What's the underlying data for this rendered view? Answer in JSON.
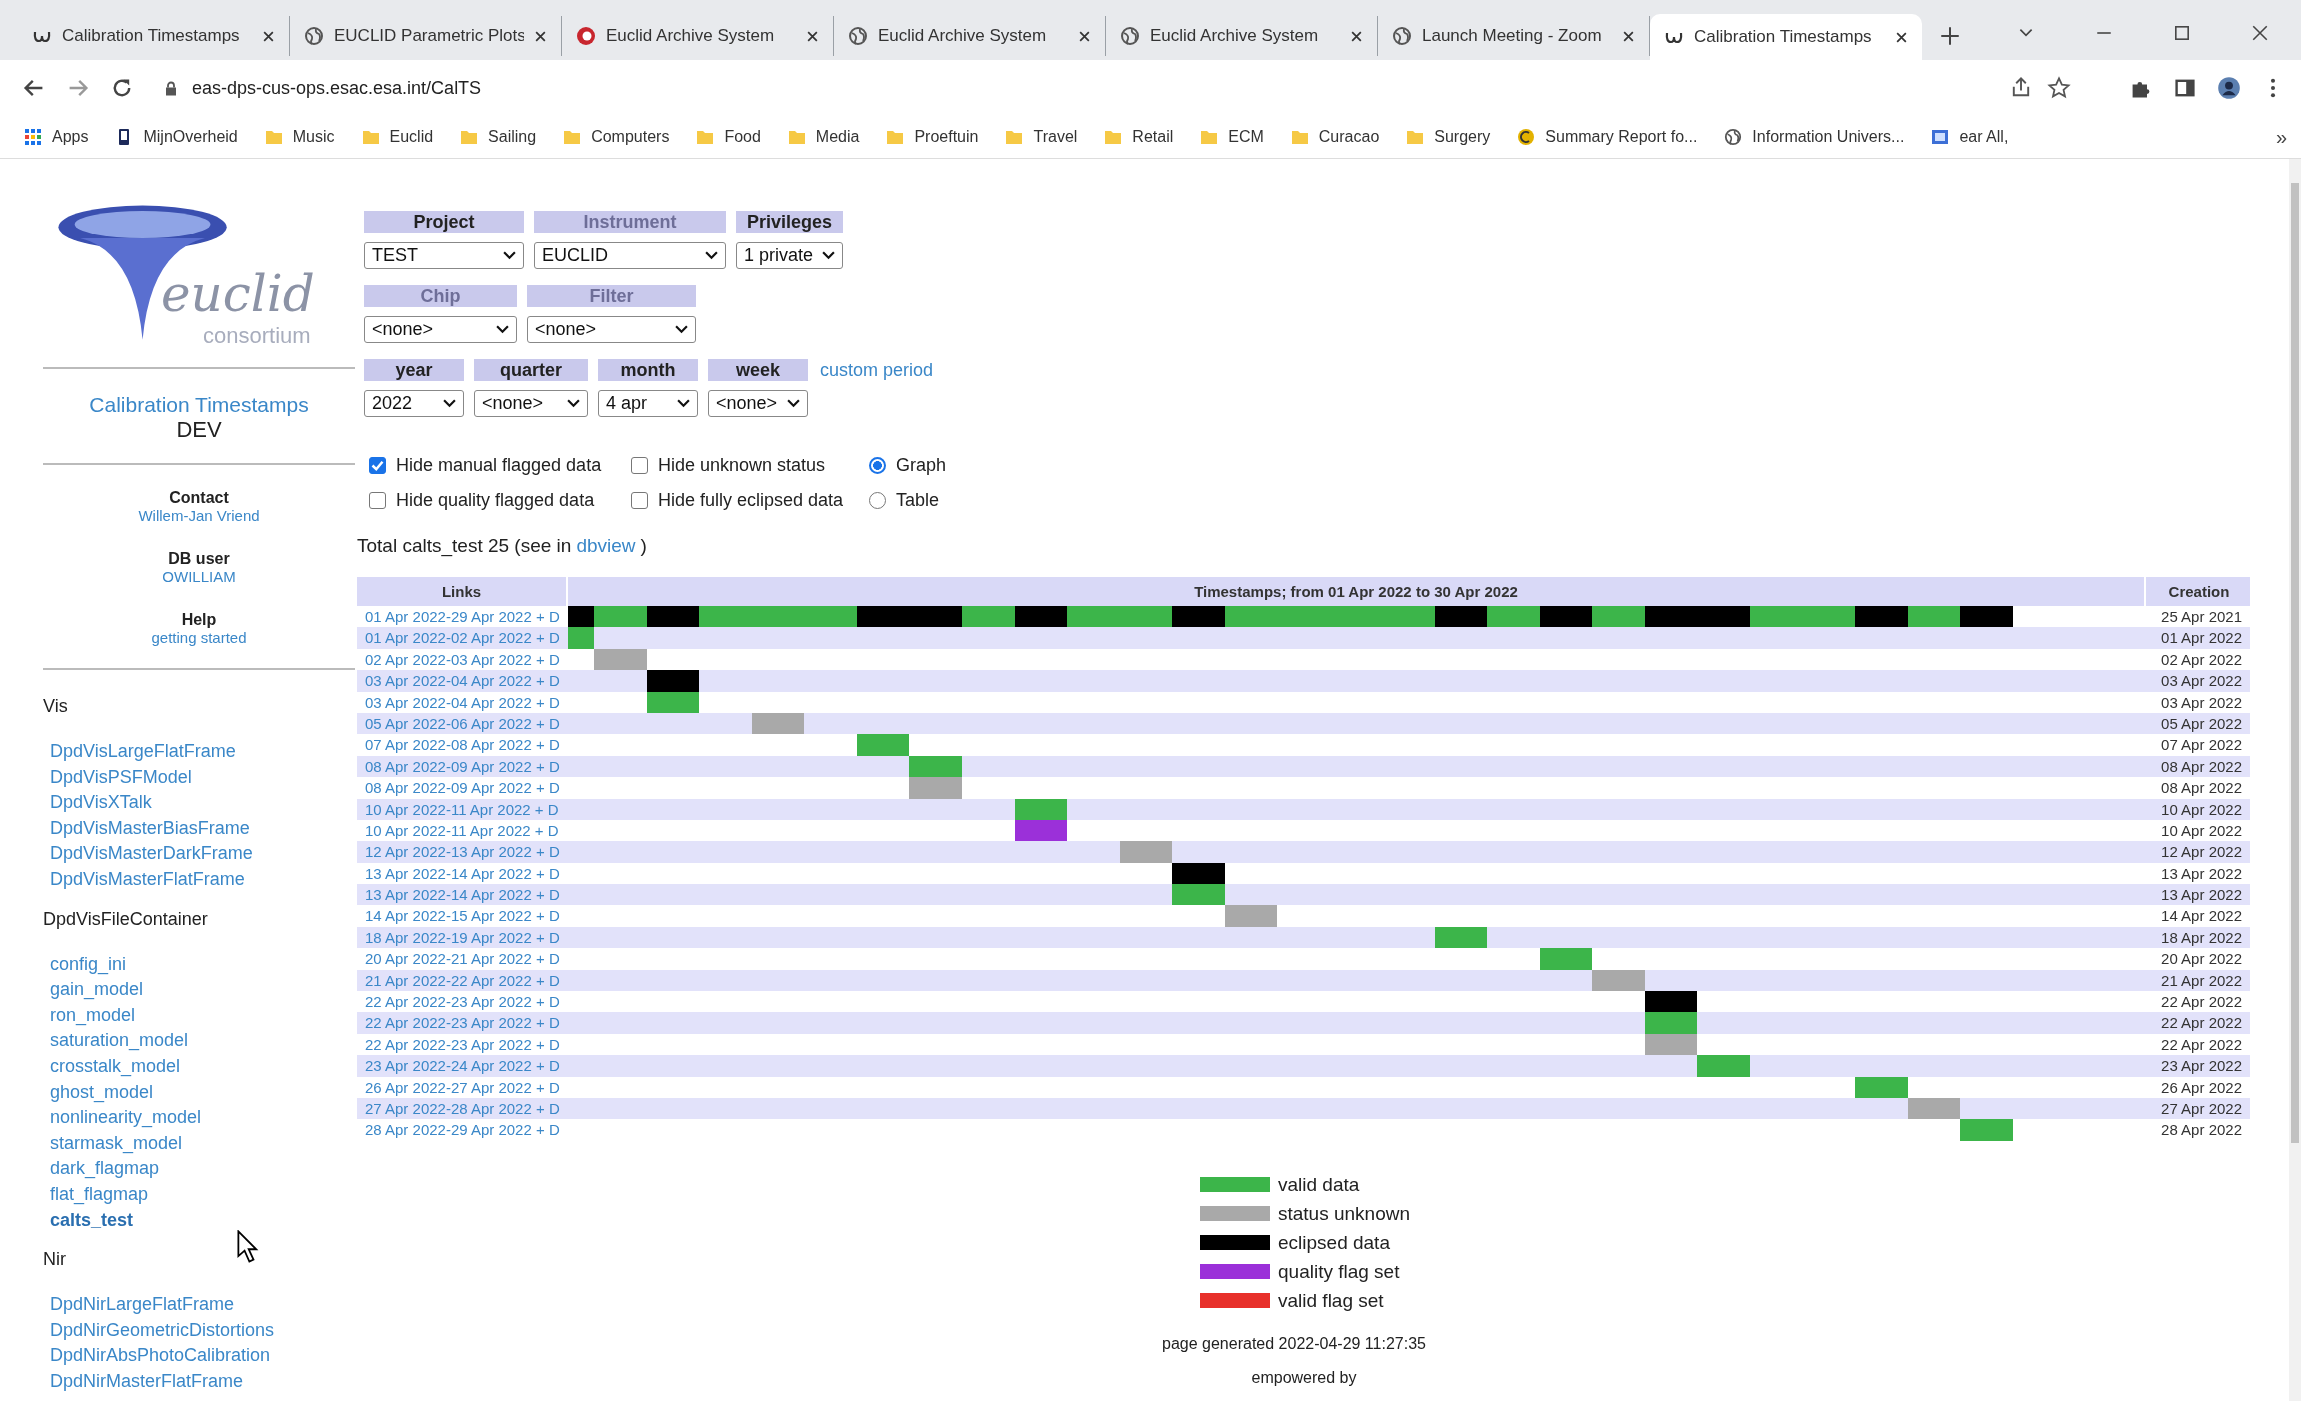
{
  "browser": {
    "tabs": [
      {
        "title": "Calibration Timestamps",
        "kind": "euclid",
        "selected": false
      },
      {
        "title": "EUCLID Parametric Plots",
        "kind": "globe",
        "selected": false
      },
      {
        "title": "Euclid Archive System",
        "kind": "archive",
        "selected": false
      },
      {
        "title": "Euclid Archive System",
        "kind": "globe",
        "selected": false
      },
      {
        "title": "Euclid Archive System",
        "kind": "globe",
        "selected": false
      },
      {
        "title": "Launch Meeting - Zoom",
        "kind": "globe",
        "selected": false
      },
      {
        "title": "Calibration Timestamps",
        "kind": "euclid",
        "selected": true
      }
    ],
    "address": "eas-dps-cus-ops.esac.esa.int/CalTS",
    "bookmarks": [
      {
        "label": "Apps",
        "kind": "apps"
      },
      {
        "label": "MijnOverheid",
        "kind": "device"
      },
      {
        "label": "Music",
        "kind": "folder"
      },
      {
        "label": "Euclid",
        "kind": "folder"
      },
      {
        "label": "Sailing",
        "kind": "folder"
      },
      {
        "label": "Computers",
        "kind": "folder"
      },
      {
        "label": "Food",
        "kind": "folder"
      },
      {
        "label": "Media",
        "kind": "folder"
      },
      {
        "label": "Proeftuin",
        "kind": "folder"
      },
      {
        "label": "Travel",
        "kind": "folder"
      },
      {
        "label": "Retail",
        "kind": "folder"
      },
      {
        "label": "ECM",
        "kind": "folder"
      },
      {
        "label": "Curacao",
        "kind": "folder"
      },
      {
        "label": "Surgery",
        "kind": "folder"
      },
      {
        "label": "Summary Report fo...",
        "kind": "coin"
      },
      {
        "label": "Information Univers...",
        "kind": "globe"
      },
      {
        "label": "ear All,",
        "kind": "doc"
      }
    ],
    "overflow": "»"
  },
  "sidebar": {
    "logo": {
      "word": "euclid",
      "sub": "consortium"
    },
    "title": "Calibration Timestamps",
    "env": "DEV",
    "info": [
      {
        "label": "Contact",
        "link": "Willem-Jan Vriend"
      },
      {
        "label": "DB user",
        "link": "OWILLIAM"
      },
      {
        "label": "Help",
        "link": "getting started"
      }
    ],
    "sections": [
      {
        "title": "Vis",
        "items": [
          {
            "label": "DpdVisLargeFlatFrame",
            "selected": false
          },
          {
            "label": "DpdVisPSFModel",
            "selected": false
          },
          {
            "label": "DpdVisXTalk",
            "selected": false
          },
          {
            "label": "DpdVisMasterBiasFrame",
            "selected": false
          },
          {
            "label": "DpdVisMasterDarkFrame",
            "selected": false
          },
          {
            "label": "DpdVisMasterFlatFrame",
            "selected": false
          }
        ]
      },
      {
        "title": "DpdVisFileContainer",
        "items": [
          {
            "label": "config_ini",
            "selected": false
          },
          {
            "label": "gain_model",
            "selected": false
          },
          {
            "label": "ron_model",
            "selected": false
          },
          {
            "label": "saturation_model",
            "selected": false
          },
          {
            "label": "crosstalk_model",
            "selected": false
          },
          {
            "label": "ghost_model",
            "selected": false
          },
          {
            "label": "nonlinearity_model",
            "selected": false
          },
          {
            "label": "starmask_model",
            "selected": false
          },
          {
            "label": "dark_flagmap",
            "selected": false
          },
          {
            "label": "flat_flagmap",
            "selected": false
          },
          {
            "label": "calts_test",
            "selected": true
          }
        ]
      },
      {
        "title": "Nir",
        "items": [
          {
            "label": "DpdNirLargeFlatFrame",
            "selected": false
          },
          {
            "label": "DpdNirGeometricDistortions",
            "selected": false
          },
          {
            "label": "DpdNirAbsPhotoCalibration",
            "selected": false
          },
          {
            "label": "DpdNirMasterFlatFrame",
            "selected": false
          }
        ]
      }
    ]
  },
  "filters": [
    [
      {
        "label": "Project",
        "value": "TEST",
        "disabled": false
      },
      {
        "label": "Instrument",
        "value": "EUCLID",
        "disabled": true
      },
      {
        "label": "Privileges",
        "value": "1 private",
        "disabled": false
      }
    ],
    [
      {
        "label": "Chip",
        "value": "<none>",
        "disabled": true
      },
      {
        "label": "Filter",
        "value": "<none>",
        "disabled": true
      }
    ],
    [
      {
        "label": "year",
        "value": "2022",
        "disabled": false
      },
      {
        "label": "quarter",
        "value": "<none>",
        "disabled": false
      },
      {
        "label": "month",
        "value": "4 apr",
        "disabled": false
      },
      {
        "label": "week",
        "value": "<none>",
        "disabled": false
      }
    ]
  ],
  "custom_period": "custom period",
  "checkboxes": [
    {
      "label": "Hide manual flagged data",
      "checked": true
    },
    {
      "label": "Hide unknown status",
      "checked": false
    },
    {
      "label": "Hide quality flagged data",
      "checked": false
    },
    {
      "label": "Hide fully eclipsed data",
      "checked": false
    }
  ],
  "views": [
    {
      "label": "Graph",
      "selected": true
    },
    {
      "label": "Table",
      "selected": false
    }
  ],
  "total": {
    "text": "Total calts_test 25 (see in",
    "link": "dbview",
    "after": ")"
  },
  "table": {
    "columns": [
      "Links",
      "Timestamps; from 01 Apr 2022 to 30 Apr 2022",
      "Creation"
    ],
    "rows": [
      {
        "link": "01 Apr 2022-29 Apr 2022 + D",
        "created": "25 Apr 2021",
        "segments": [
          {
            "kind": "eclipsed"
          },
          {
            "kind": "valid"
          },
          {
            "kind": "eclipsed"
          },
          {
            "kind": "valid"
          },
          {
            "kind": "eclipsed"
          },
          {
            "kind": "valid"
          },
          {
            "kind": "eclipsed"
          },
          {
            "kind": "valid"
          },
          {
            "kind": "eclipsed"
          },
          {
            "kind": "valid"
          },
          {
            "kind": "eclipsed"
          },
          {
            "kind": "valid"
          },
          {
            "kind": "eclipsed"
          },
          {
            "kind": "valid"
          },
          {
            "kind": "eclipsed"
          },
          {
            "kind": "valid"
          },
          {
            "kind": "eclipsed"
          },
          {
            "kind": "valid"
          },
          {
            "kind": "eclipsed"
          }
        ]
      },
      {
        "link": "01 Apr 2022-02 Apr 2022 + D",
        "created": "01 Apr 2022",
        "segments": [
          {
            "kind": "valid"
          }
        ]
      },
      {
        "link": "02 Apr 2022-03 Apr 2022 + D",
        "created": "02 Apr 2022",
        "segments": [
          {
            "kind": "unknown"
          }
        ]
      },
      {
        "link": "03 Apr 2022-04 Apr 2022 + D",
        "created": "03 Apr 2022",
        "segments": [
          {
            "kind": "eclipsed"
          }
        ]
      },
      {
        "link": "03 Apr 2022-04 Apr 2022 + D",
        "created": "03 Apr 2022",
        "segments": [
          {
            "kind": "valid"
          }
        ]
      },
      {
        "link": "05 Apr 2022-06 Apr 2022 + D",
        "created": "05 Apr 2022",
        "segments": [
          {
            "kind": "unknown"
          }
        ]
      },
      {
        "link": "07 Apr 2022-08 Apr 2022 + D",
        "created": "07 Apr 2022",
        "segments": [
          {
            "kind": "valid"
          }
        ]
      },
      {
        "link": "08 Apr 2022-09 Apr 2022 + D",
        "created": "08 Apr 2022",
        "segments": [
          {
            "kind": "valid"
          }
        ]
      },
      {
        "link": "08 Apr 2022-09 Apr 2022 + D",
        "created": "08 Apr 2022",
        "segments": [
          {
            "kind": "unknown"
          }
        ]
      },
      {
        "link": "10 Apr 2022-11 Apr 2022 + D",
        "created": "10 Apr 2022",
        "segments": [
          {
            "kind": "valid"
          }
        ]
      },
      {
        "link": "10 Apr 2022-11 Apr 2022 + D",
        "created": "10 Apr 2022",
        "segments": [
          {
            "kind": "quality"
          }
        ]
      },
      {
        "link": "12 Apr 2022-13 Apr 2022 + D",
        "created": "12 Apr 2022",
        "segments": [
          {
            "kind": "unknown"
          }
        ]
      },
      {
        "link": "13 Apr 2022-14 Apr 2022 + D",
        "created": "13 Apr 2022",
        "segments": [
          {
            "kind": "eclipsed"
          }
        ]
      },
      {
        "link": "13 Apr 2022-14 Apr 2022 + D",
        "created": "13 Apr 2022",
        "segments": [
          {
            "kind": "valid"
          }
        ]
      },
      {
        "link": "14 Apr 2022-15 Apr 2022 + D",
        "created": "14 Apr 2022",
        "segments": [
          {
            "kind": "unknown"
          }
        ]
      },
      {
        "link": "18 Apr 2022-19 Apr 2022 + D",
        "created": "18 Apr 2022",
        "segments": [
          {
            "kind": "valid"
          }
        ]
      },
      {
        "link": "20 Apr 2022-21 Apr 2022 + D",
        "created": "20 Apr 2022",
        "segments": [
          {
            "kind": "valid"
          }
        ]
      },
      {
        "link": "21 Apr 2022-22 Apr 2022 + D",
        "created": "21 Apr 2022",
        "segments": [
          {
            "kind": "unknown"
          }
        ]
      },
      {
        "link": "22 Apr 2022-23 Apr 2022 + D",
        "created": "22 Apr 2022",
        "segments": [
          {
            "kind": "eclipsed"
          }
        ]
      },
      {
        "link": "22 Apr 2022-23 Apr 2022 + D",
        "created": "22 Apr 2022",
        "segments": [
          {
            "kind": "valid"
          }
        ]
      },
      {
        "link": "22 Apr 2022-23 Apr 2022 + D",
        "created": "22 Apr 2022",
        "segments": [
          {
            "kind": "unknown"
          }
        ]
      },
      {
        "link": "23 Apr 2022-24 Apr 2022 + D",
        "created": "23 Apr 2022",
        "segments": [
          {
            "kind": "valid"
          }
        ]
      },
      {
        "link": "26 Apr 2022-27 Apr 2022 + D",
        "created": "26 Apr 2022",
        "segments": [
          {
            "kind": "valid"
          }
        ]
      },
      {
        "link": "27 Apr 2022-28 Apr 2022 + D",
        "created": "27 Apr 2022",
        "segments": [
          {
            "kind": "unknown"
          }
        ]
      },
      {
        "link": "28 Apr 2022-29 Apr 2022 + D",
        "created": "28 Apr 2022",
        "segments": [
          {
            "kind": "valid"
          }
        ]
      }
    ]
  },
  "legend": [
    {
      "label": "valid data",
      "color": "#3cb54a"
    },
    {
      "label": "status unknown",
      "color": "#a9a9a9"
    },
    {
      "label": "eclipsed data",
      "color": "#000000"
    },
    {
      "label": "quality flag set",
      "color": "#9b30d9"
    },
    {
      "label": "valid flag set",
      "color": "#e8302a"
    }
  ],
  "footer": {
    "generated": "page generated 2022-04-29 11:27:35",
    "powered": "empowered by"
  }
}
